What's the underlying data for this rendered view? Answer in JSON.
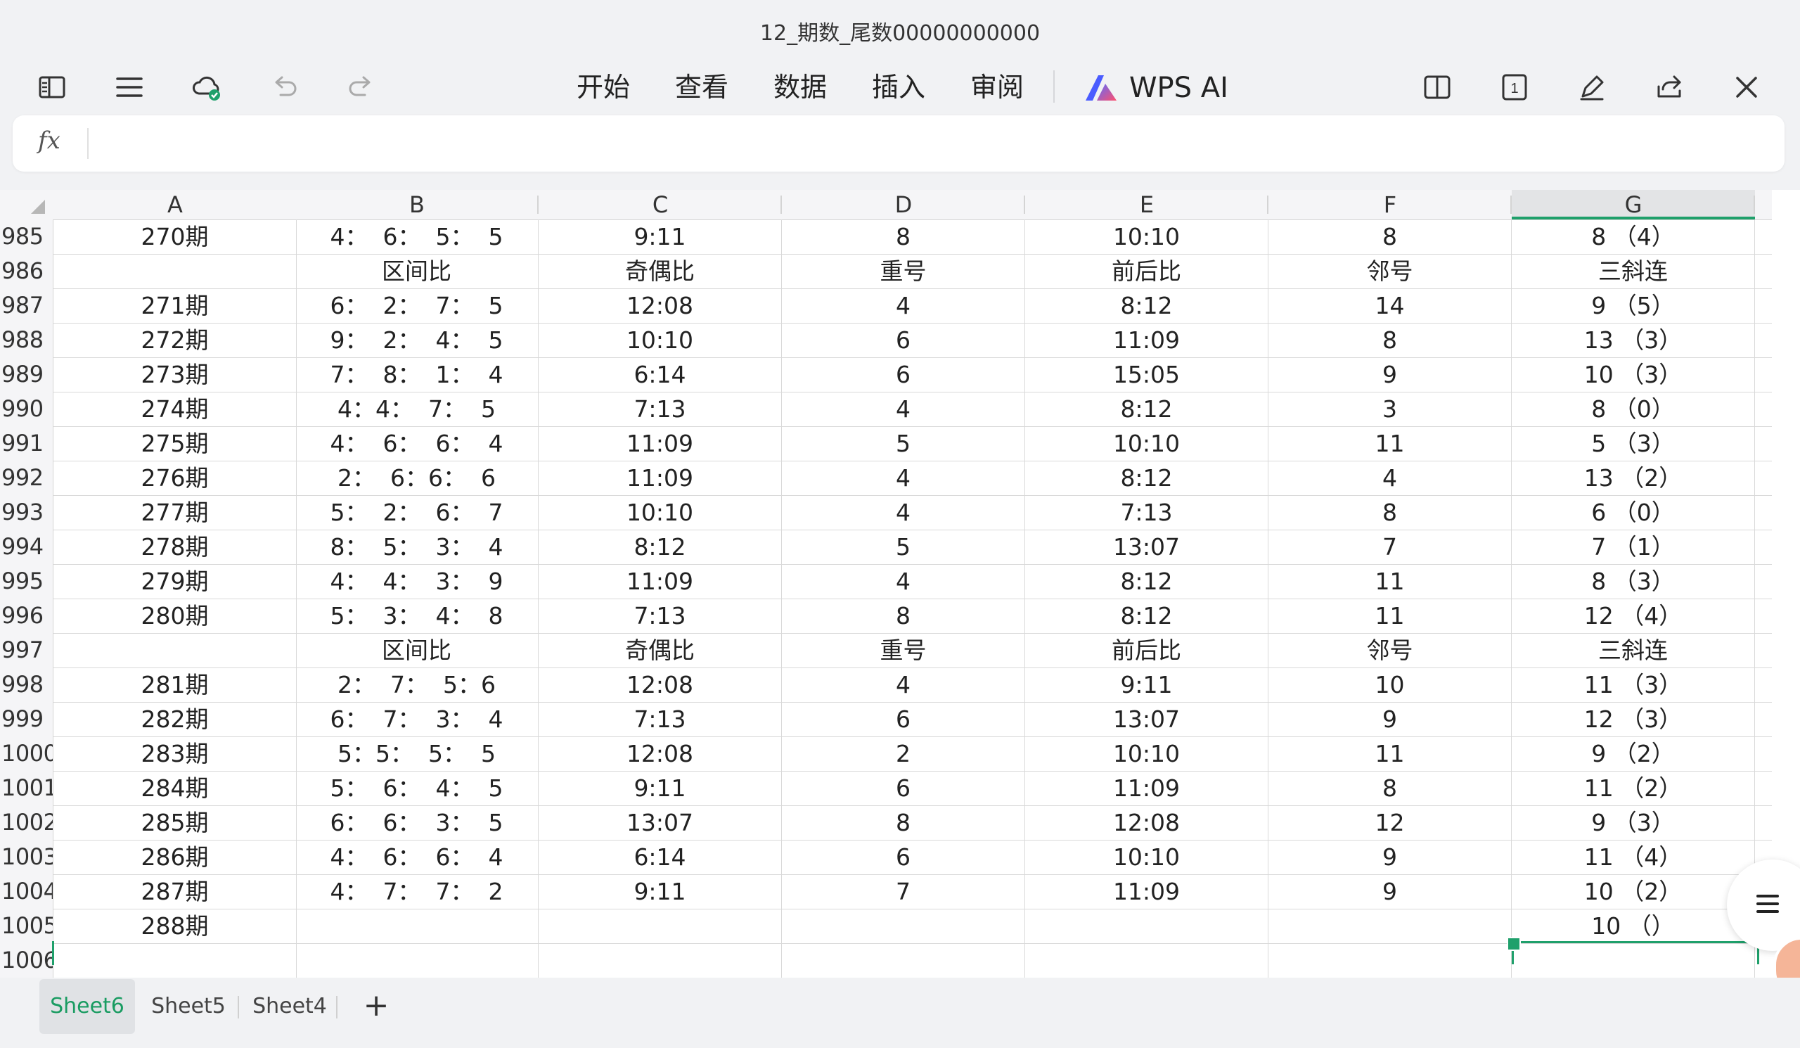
{
  "window": {
    "title": "12_期数_尾数00000000000"
  },
  "toolbar": {
    "left_icons": [
      "sidebar-toggle-icon",
      "menu-icon",
      "cloud-sync-icon",
      "undo-icon",
      "redo-icon"
    ],
    "menu": [
      "开始",
      "查看",
      "数据",
      "插入",
      "审阅"
    ],
    "ai_label": "WPS AI",
    "right_icons": [
      "split-view-icon",
      "page-count-icon",
      "edit-pen-icon",
      "share-icon",
      "close-icon"
    ],
    "page_count": "1"
  },
  "formula_bar": {
    "fx_label": "fx",
    "value": ""
  },
  "columns": [
    "A",
    "B",
    "C",
    "D",
    "E",
    "F",
    "G"
  ],
  "active_column": "G",
  "rows": [
    {
      "num": "985",
      "cells": [
        "270期",
        "4：  6：  5：  5",
        "9:11",
        "8",
        "10:10",
        "8",
        "8 （4）"
      ]
    },
    {
      "num": "986",
      "cells": [
        "",
        "区间比",
        "奇偶比",
        "重号",
        "前后比",
        "邻号",
        "三斜连"
      ]
    },
    {
      "num": "987",
      "cells": [
        "271期",
        "6：  2：  7：  5",
        "12:08",
        "4",
        "8:12",
        "14",
        "9 （5）"
      ]
    },
    {
      "num": "988",
      "cells": [
        "272期",
        "9：  2：  4：  5",
        "10:10",
        "6",
        "11:09",
        "8",
        "13 （3）"
      ]
    },
    {
      "num": "989",
      "cells": [
        "273期",
        "7：  8：  1：  4",
        "6:14",
        "6",
        "15:05",
        "9",
        "10 （3）"
      ]
    },
    {
      "num": "990",
      "cells": [
        "274期",
        "4：4：  7：  5",
        "7:13",
        "4",
        "8:12",
        "3",
        "8 （0）"
      ]
    },
    {
      "num": "991",
      "cells": [
        "275期",
        "4：  6：  6：  4",
        "11:09",
        "5",
        "10:10",
        "11",
        "5 （3）"
      ]
    },
    {
      "num": "992",
      "cells": [
        "276期",
        "2：  6：6：  6",
        "11:09",
        "4",
        "8:12",
        "4",
        "13 （2）"
      ]
    },
    {
      "num": "993",
      "cells": [
        "277期",
        "5：  2：  6：  7",
        "10:10",
        "4",
        "7:13",
        "8",
        "6 （0）"
      ]
    },
    {
      "num": "994",
      "cells": [
        "278期",
        "8：  5：  3：  4",
        "8:12",
        "5",
        "13:07",
        "7",
        "7 （1）"
      ]
    },
    {
      "num": "995",
      "cells": [
        "279期",
        "4：  4：  3：  9",
        "11:09",
        "4",
        "8:12",
        "11",
        "8 （3）"
      ]
    },
    {
      "num": "996",
      "cells": [
        "280期",
        "5：  3：  4：  8",
        "7:13",
        "8",
        "8:12",
        "11",
        "12 （4）"
      ]
    },
    {
      "num": "997",
      "cells": [
        "",
        "区间比",
        "奇偶比",
        "重号",
        "前后比",
        "邻号",
        "三斜连"
      ]
    },
    {
      "num": "998",
      "cells": [
        "281期",
        "2：  7：  5：6",
        "12:08",
        "4",
        "9:11",
        "10",
        "11 （3）"
      ]
    },
    {
      "num": "999",
      "cells": [
        "282期",
        "6：  7：  3：  4",
        "7:13",
        "6",
        "13:07",
        "9",
        "12 （3）"
      ]
    },
    {
      "num": "1000",
      "cells": [
        "283期",
        "5：5：  5：  5",
        "12:08",
        "2",
        "10:10",
        "11",
        "9 （2）"
      ]
    },
    {
      "num": "1001",
      "cells": [
        "284期",
        "5：  6：  4：  5",
        "9:11",
        "6",
        "11:09",
        "8",
        "11 （2）"
      ]
    },
    {
      "num": "1002",
      "cells": [
        "285期",
        "6：  6：  3：  5",
        "13:07",
        "8",
        "12:08",
        "12",
        "9 （3）"
      ]
    },
    {
      "num": "1003",
      "cells": [
        "286期",
        "4：  6：  6：  4",
        "6:14",
        "6",
        "10:10",
        "9",
        "11 （4）"
      ]
    },
    {
      "num": "1004",
      "cells": [
        "287期",
        "4：  7：  7：  2",
        "9:11",
        "7",
        "11:09",
        "9",
        "10 （2）"
      ]
    },
    {
      "num": "1005",
      "cells": [
        "288期",
        "",
        "",
        "",
        "",
        "",
        "10 （）"
      ]
    },
    {
      "num": "1006",
      "cells": [
        "",
        "",
        "",
        "",
        "",
        "",
        ""
      ]
    }
  ],
  "sheet_tabs": [
    {
      "label": "Sheet6",
      "active": true
    },
    {
      "label": "Sheet5",
      "active": false
    },
    {
      "label": "Sheet4",
      "active": false
    }
  ],
  "add_sheet_label": "+",
  "colors": {
    "accent": "#1fa06b",
    "ai_gradient": [
      "#5b6cff",
      "#ff4f6d"
    ]
  }
}
